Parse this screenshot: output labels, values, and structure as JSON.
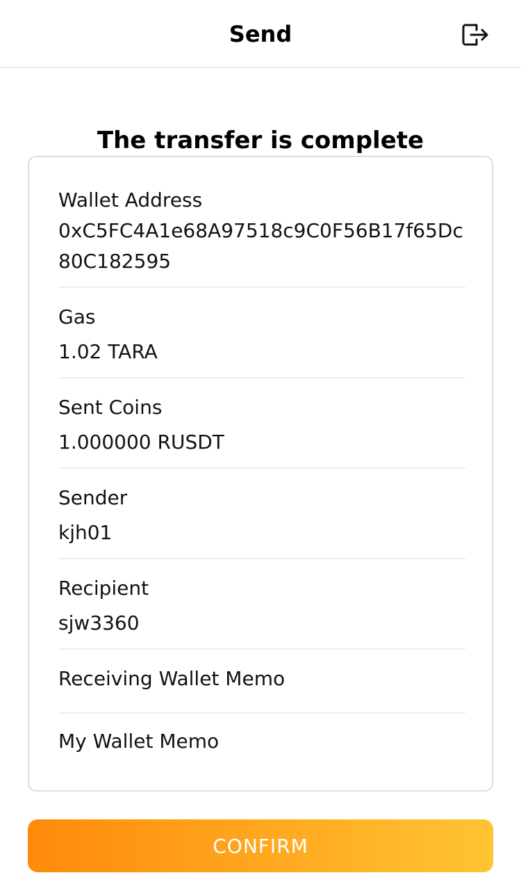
{
  "header": {
    "title": "Send",
    "logout_icon": "logout-icon"
  },
  "status_title": "The transfer is complete",
  "details": {
    "wallet_address": {
      "label": "Wallet Address",
      "value": "0xC5FC4A1e68A97518c9C0F56B17f65Dc80C182595"
    },
    "gas": {
      "label": "Gas",
      "value": "1.02 TARA"
    },
    "sent_coins": {
      "label": "Sent Coins",
      "value": "1.000000 RUSDT"
    },
    "sender": {
      "label": "Sender",
      "value": "kjh01"
    },
    "recipient": {
      "label": "Recipient",
      "value": "sjw3360"
    },
    "receiving_wallet_memo": {
      "label": "Receiving Wallet Memo",
      "value": ""
    },
    "my_wallet_memo": {
      "label": "My Wallet Memo",
      "value": ""
    }
  },
  "confirm_button": {
    "label": "CONFIRM"
  },
  "colors": {
    "button_gradient_start": "#ff8a0a",
    "button_gradient_end": "#ffc433",
    "border": "#dddddd",
    "divider": "#eeeeee"
  }
}
